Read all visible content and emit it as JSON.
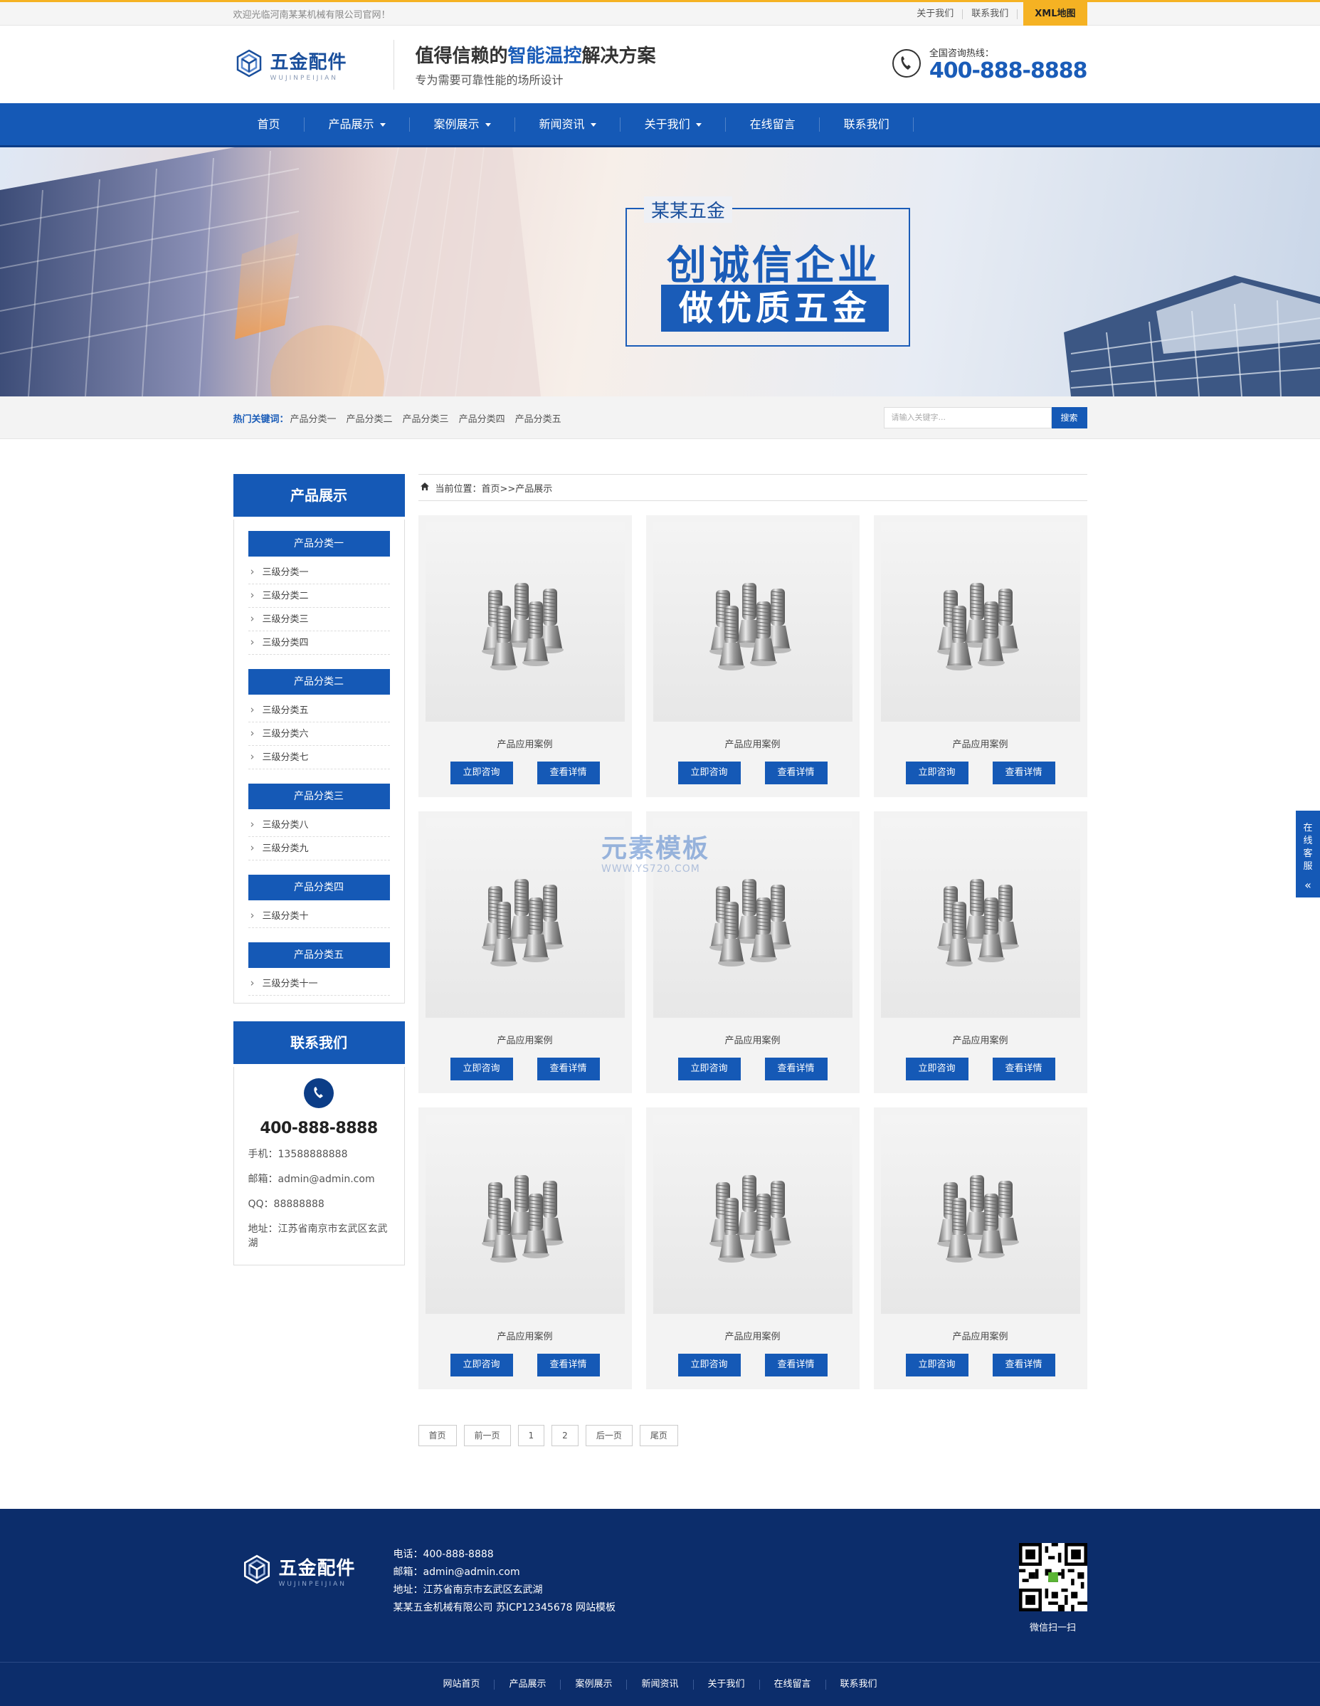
{
  "topbar": {
    "welcome": "欢迎光临河南某某机械有限公司官网！",
    "links": [
      "关于我们",
      "联系我们"
    ],
    "xml": "XML地图"
  },
  "header": {
    "logo_cn": "五金配件",
    "logo_en": "WUJINPEIJIAN",
    "slogan_pre": "值得信赖的",
    "slogan_hl": "智能温控",
    "slogan_post": "解决方案",
    "slogan_sub": "专为需要可靠性能的场所设计",
    "hotline_label": "全国咨询热线：",
    "hotline": "400-888-8888"
  },
  "nav": [
    "首页",
    "产品展示",
    "案例展示",
    "新闻资讯",
    "关于我们",
    "在线留言",
    "联系我们"
  ],
  "banner": {
    "title": "某某五金",
    "big": "创诚信企业",
    "band": "做优质五金"
  },
  "search": {
    "hot_label": "热门关键词：",
    "keywords": [
      "产品分类一",
      "产品分类二",
      "产品分类三",
      "产品分类四",
      "产品分类五"
    ],
    "placeholder": "请输入关键字...",
    "button": "搜索"
  },
  "sidebar": {
    "title": "产品展示",
    "categories": [
      {
        "name": "产品分类一",
        "subs": [
          "三级分类一",
          "三级分类二",
          "三级分类三",
          "三级分类四"
        ]
      },
      {
        "name": "产品分类二",
        "subs": [
          "三级分类五",
          "三级分类六",
          "三级分类七"
        ]
      },
      {
        "name": "产品分类三",
        "subs": [
          "三级分类八",
          "三级分类九"
        ]
      },
      {
        "name": "产品分类四",
        "subs": [
          "三级分类十"
        ]
      },
      {
        "name": "产品分类五",
        "subs": [
          "三级分类十一"
        ]
      }
    ],
    "contact_title": "联系我们",
    "contact_phone": "400-888-8888",
    "mobile": "手机：13588888888",
    "email": "邮箱：admin@admin.com",
    "qq": "QQ：88888888",
    "address": "地址：江苏省南京市玄武区玄武湖"
  },
  "breadcrumb": "当前位置：首页>>产品展示",
  "products": {
    "title": "产品应用案例",
    "consult": "立即咨询",
    "detail": "查看详情",
    "count": 9
  },
  "pager": [
    "首页",
    "前一页",
    "1",
    "2",
    "后一页",
    "尾页"
  ],
  "footer": {
    "logo_cn": "五金配件",
    "logo_en": "WUJINPEIJIAN",
    "tel": "电话：400-888-8888",
    "email": "邮箱：admin@admin.com",
    "address": "地址：江苏省南京市玄武区玄武湖",
    "copyright": "某某五金机械有限公司 苏ICP12345678 网站模板",
    "qr_caption": "微信扫一扫",
    "nav": [
      "网站首页",
      "产品展示",
      "案例展示",
      "新闻资讯",
      "关于我们",
      "在线留言",
      "联系我们"
    ]
  },
  "service": {
    "label": "在线客服"
  },
  "watermark": {
    "main": "元素模板",
    "sub": "WWW.YS720.COM"
  },
  "colors": {
    "primary": "#1559b6",
    "accent": "#f5b223",
    "footer": "#0c2d6b"
  }
}
